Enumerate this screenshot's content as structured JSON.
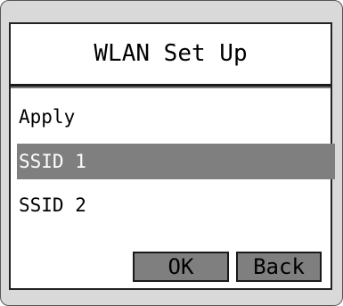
{
  "dialog": {
    "title": "WLAN Set Up"
  },
  "menu": {
    "items": [
      {
        "label": "Apply",
        "selected": false
      },
      {
        "label": "SSID 1",
        "selected": true
      },
      {
        "label": "SSID 2",
        "selected": false
      }
    ]
  },
  "buttons": {
    "ok_label": "OK",
    "back_label": "Back"
  },
  "colors": {
    "selection": "#7f7f7f",
    "frame": "#d9d9d9"
  }
}
